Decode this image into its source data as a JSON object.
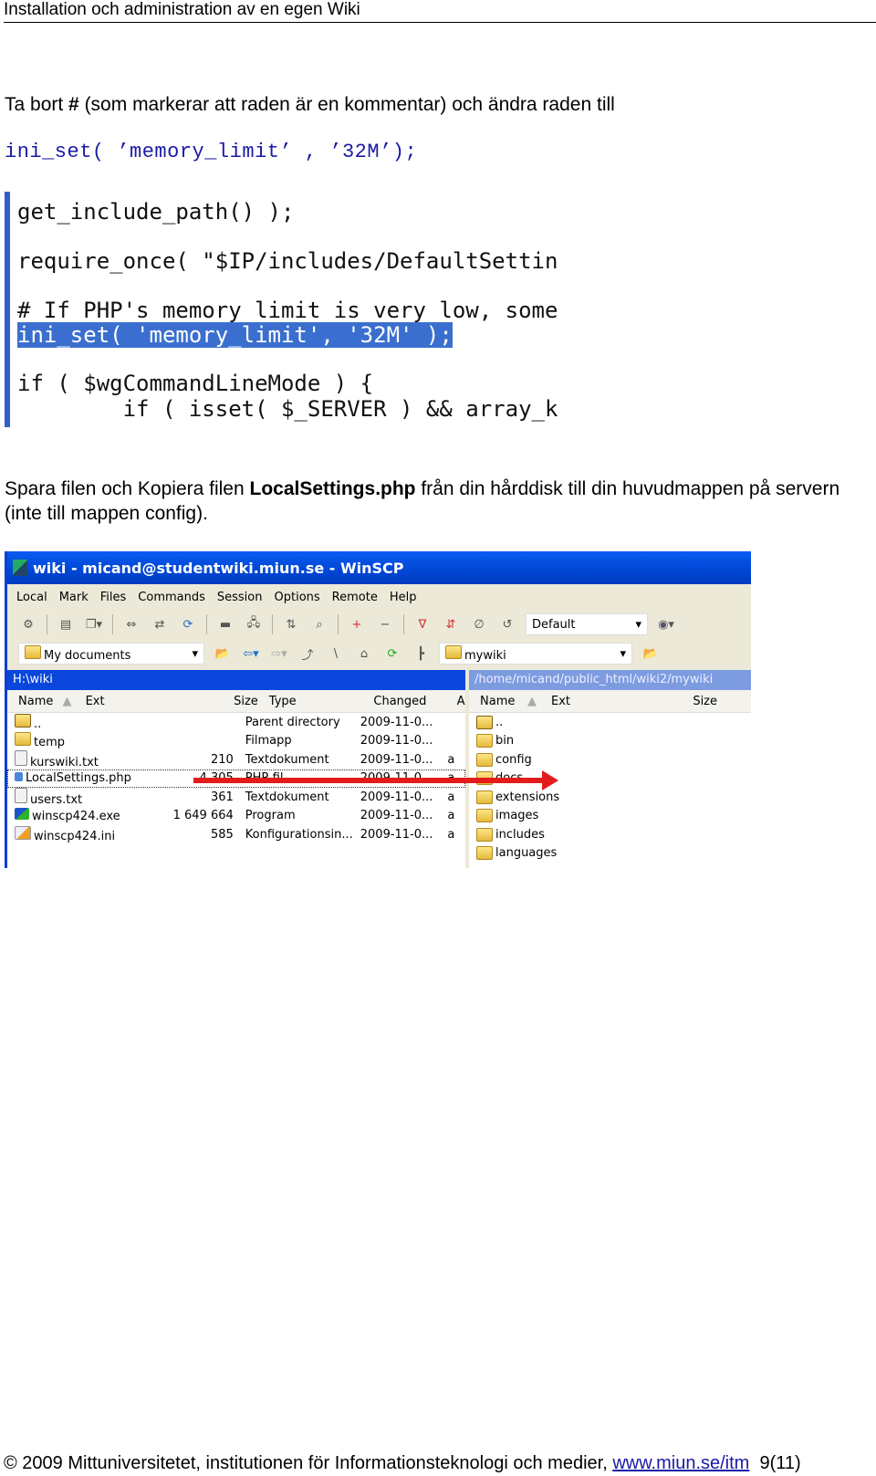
{
  "header": {
    "title": "Installation och administration av en egen Wiki"
  },
  "instruction1": {
    "before": "Ta bort ",
    "bold": "#",
    "after": " (som markerar att raden är en kommentar) och ändra raden till"
  },
  "code_example": "ini_set( ’memory_limit’ , ’32M’);",
  "code_screenshot": {
    "lines": [
      "get_include_path() );",
      "require_once( \"$IP/includes/DefaultSettin",
      "# If PHP's memory limit is very low, some",
      "ini_set( 'memory_limit', '32M' );",
      "if ( $wgCommandLineMode ) {",
      "        if ( isset( $_SERVER ) && array_k"
    ],
    "highlighted_line_index": 3
  },
  "instruction2": {
    "before": "Spara filen och Kopiera filen ",
    "bold": "LocalSettings.php",
    "after": " från din hårddisk till din huvudmappen på servern (inte till mappen config)."
  },
  "winscp": {
    "title": "wiki - micand@studentwiki.miun.se - WinSCP",
    "menu": [
      "Local",
      "Mark",
      "Files",
      "Commands",
      "Session",
      "Options",
      "Remote",
      "Help"
    ],
    "session_combo": "Default",
    "local_combo": "My documents",
    "remote_combo": "mywiki",
    "local_path": "H:\\wiki",
    "remote_path": "/home/micand/public_html/wiki2/mywiki",
    "local_columns": [
      "Name",
      "Ext",
      "Size",
      "Type",
      "Changed",
      "A"
    ],
    "remote_columns": [
      "Name",
      "Ext",
      "Size"
    ],
    "local_files": [
      {
        "name": "..",
        "size": "",
        "type": "Parent directory",
        "changed": "2009-11-0...",
        "attr": "",
        "icon": "parent-dir-icon"
      },
      {
        "name": "temp",
        "size": "",
        "type": "Filmapp",
        "changed": "2009-11-0...",
        "attr": "",
        "icon": "folder-icon"
      },
      {
        "name": "kurswiki.txt",
        "size": "210",
        "type": "Textdokument",
        "changed": "2009-11-0...",
        "attr": "a",
        "icon": "text-file-icon"
      },
      {
        "name": "LocalSettings.php",
        "size": "4 305",
        "type": "PHP-fil",
        "changed": "2009-11-0...",
        "attr": "a",
        "icon": "php-file-icon"
      },
      {
        "name": "users.txt",
        "size": "361",
        "type": "Textdokument",
        "changed": "2009-11-0...",
        "attr": "a",
        "icon": "text-file-icon"
      },
      {
        "name": "winscp424.exe",
        "size": "1 649 664",
        "type": "Program",
        "changed": "2009-11-0...",
        "attr": "a",
        "icon": "exe-file-icon"
      },
      {
        "name": "winscp424.ini",
        "size": "585",
        "type": "Konfigurationsin...",
        "changed": "2009-11-0...",
        "attr": "a",
        "icon": "ini-file-icon"
      }
    ],
    "remote_files": [
      "..",
      "bin",
      "config",
      "docs",
      "extensions",
      "images",
      "includes",
      "languages"
    ]
  },
  "footer": {
    "text": "© 2009 Mittuniversitetet, institutionen för Informationsteknologi och medier, ",
    "link": "www.miun.se/itm",
    "page": "9(11)"
  }
}
